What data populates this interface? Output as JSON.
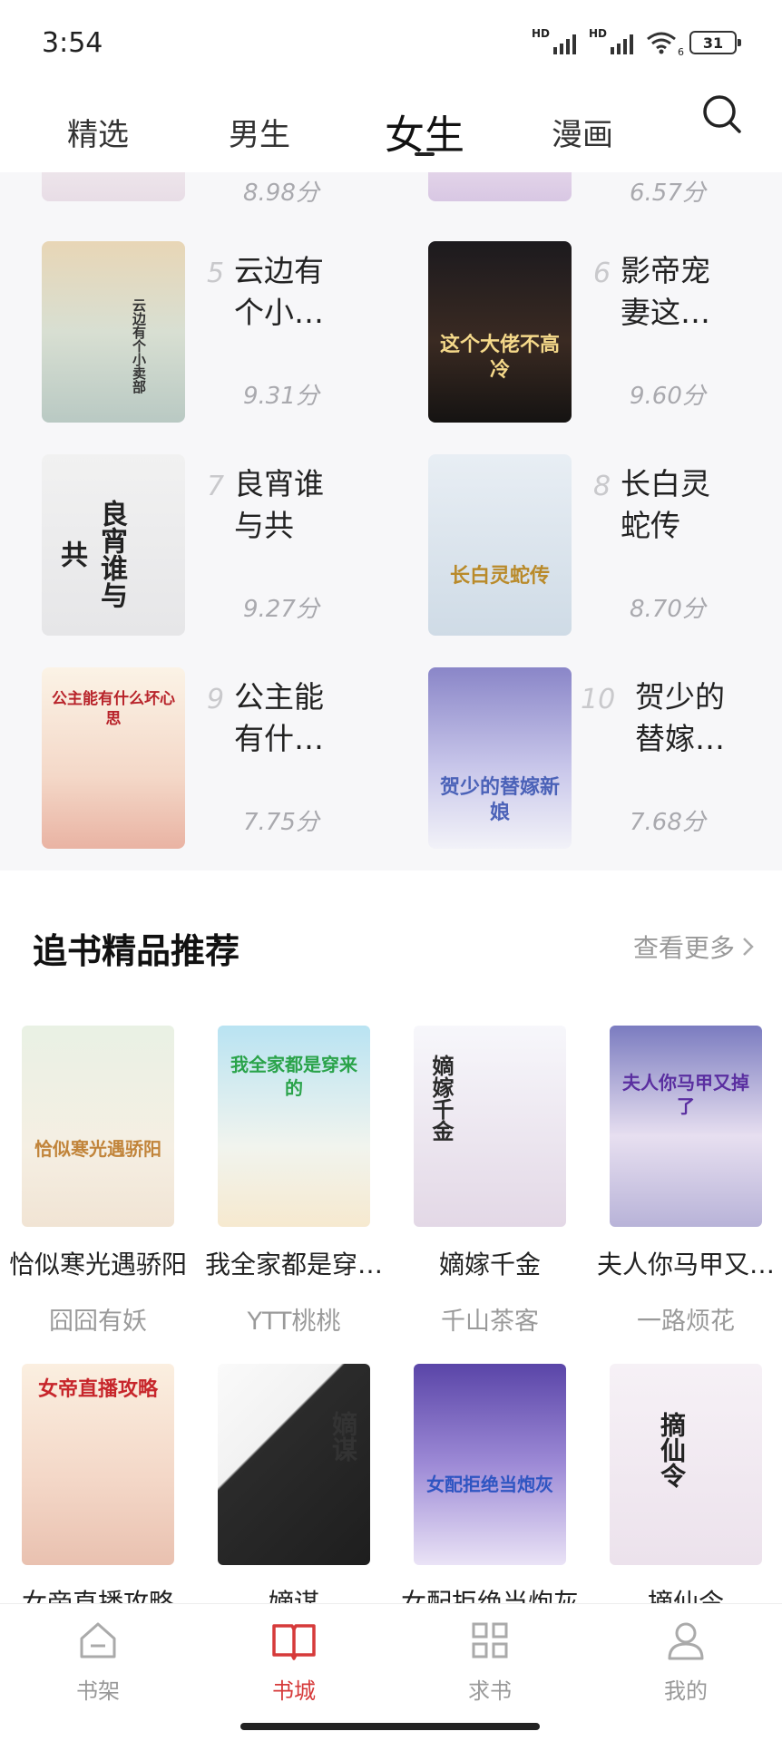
{
  "status": {
    "time": "3:54",
    "signal1": "HD",
    "signal2": "HD",
    "wifi_sub": "6",
    "battery": "31"
  },
  "tabs": [
    {
      "label": "精选",
      "active": false
    },
    {
      "label": "男生",
      "active": false
    },
    {
      "label": "女生",
      "active": true
    },
    {
      "label": "漫画",
      "active": false
    }
  ],
  "ranking": {
    "partial_scores": [
      "8.98分",
      "6.57分"
    ],
    "items": [
      {
        "rank": "5",
        "title": "云边有个小…",
        "score": "9.31分",
        "cover_text": "云边有个小卖部"
      },
      {
        "rank": "6",
        "title": "影帝宠妻这…",
        "score": "9.60分",
        "cover_text": "这个大佬不高冷"
      },
      {
        "rank": "7",
        "title": "良宵谁与共",
        "score": "9.27分",
        "cover_text": "良宵谁与共"
      },
      {
        "rank": "8",
        "title": "长白灵蛇传",
        "score": "8.70分",
        "cover_text": "长白灵蛇传"
      },
      {
        "rank": "9",
        "title": "公主能有什…",
        "score": "7.75分",
        "cover_text": "公主能有什么坏心思"
      },
      {
        "rank": "10",
        "title": "贺少的替嫁…",
        "score": "7.68分",
        "cover_text": "贺少的替嫁新娘"
      }
    ]
  },
  "recommend": {
    "title": "追书精品推荐",
    "more": "查看更多",
    "books": [
      {
        "title": "恰似寒光遇骄阳",
        "author": "囧囧有妖",
        "cover_text": "恰似寒光遇骄阳"
      },
      {
        "title": "我全家都是穿…",
        "author": "YTT桃桃",
        "cover_text": "我全家都是穿来的"
      },
      {
        "title": "嫡嫁千金",
        "author": "千山茶客",
        "cover_text": "嫡嫁千金"
      },
      {
        "title": "夫人你马甲又…",
        "author": "一路烦花",
        "cover_text": "夫人你马甲又掉了"
      },
      {
        "title": "女帝直播攻略",
        "author": "",
        "cover_text": "女帝直播攻略"
      },
      {
        "title": "嫡谋",
        "author": "",
        "cover_text": "嫡谋"
      },
      {
        "title": "女配拒绝当炮灰",
        "author": "",
        "cover_text": "女配拒绝当炮灰"
      },
      {
        "title": "摘仙令",
        "author": "",
        "cover_text": "摘仙令"
      }
    ]
  },
  "bottom_nav": [
    {
      "label": "书架",
      "icon": "bookshelf-icon",
      "active": false
    },
    {
      "label": "书城",
      "icon": "book-open-icon",
      "active": true
    },
    {
      "label": "求书",
      "icon": "grid-icon",
      "active": false
    },
    {
      "label": "我的",
      "icon": "person-icon",
      "active": false
    }
  ],
  "colors": {
    "accent": "#d63a3a",
    "muted": "#999999",
    "rank_bg": "#f7f7f9"
  }
}
